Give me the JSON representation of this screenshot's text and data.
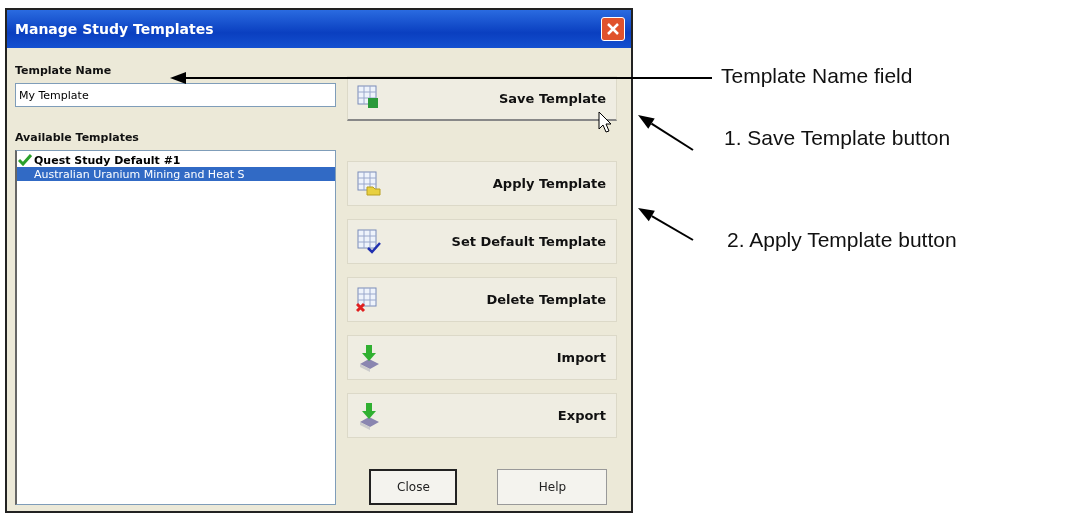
{
  "window": {
    "title": "Manage Study Templates"
  },
  "template_name": {
    "label": "Template Name",
    "value": "My Template"
  },
  "available_templates": {
    "label": "Available Templates",
    "items": [
      {
        "name": "Quest Study Default #1",
        "is_default": true,
        "selected": false
      },
      {
        "name": "Australian Uranium Mining and Heat S",
        "is_default": false,
        "selected": true
      }
    ]
  },
  "actions": [
    {
      "label": "Save Template",
      "kind": "save",
      "hovered": true
    },
    {
      "label": "Apply Template",
      "kind": "apply",
      "hovered": false
    },
    {
      "label": "Set Default Template",
      "kind": "default",
      "hovered": false
    },
    {
      "label": "Delete Template",
      "kind": "delete",
      "hovered": false
    },
    {
      "label": "Import",
      "kind": "import",
      "hovered": false
    },
    {
      "label": "Export",
      "kind": "export",
      "hovered": false
    }
  ],
  "footer_buttons": [
    {
      "label": "Close",
      "focused": true
    },
    {
      "label": "Help",
      "focused": false
    }
  ],
  "annotations": [
    {
      "text": "Template Name field",
      "kind": "field"
    },
    {
      "text": "1. Save Template button",
      "kind": "save"
    },
    {
      "text": "2. Apply Template button",
      "kind": "apply"
    }
  ]
}
